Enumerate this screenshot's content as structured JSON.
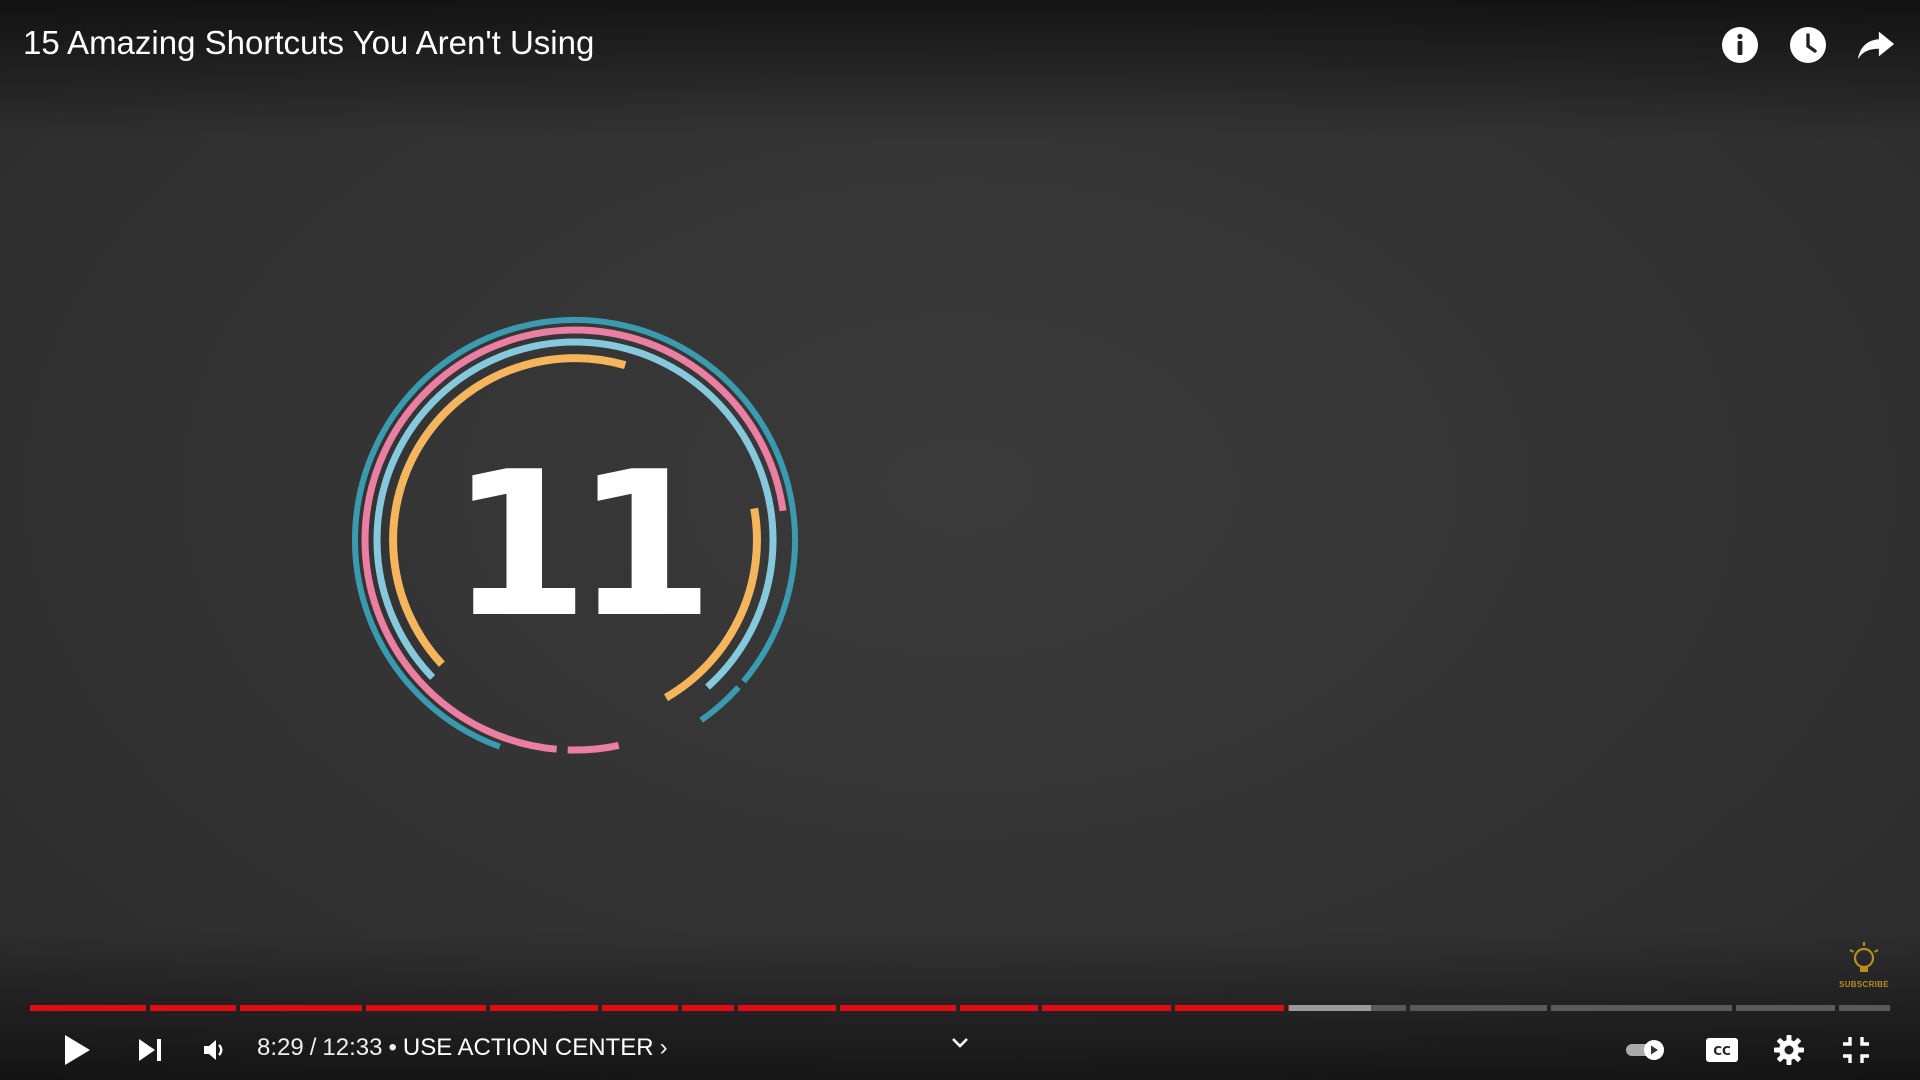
{
  "video": {
    "title": "15 Amazing Shortcuts You Aren't Using",
    "emblem_number": "11"
  },
  "top_actions": {
    "info_icon": "info-icon",
    "watch_later_icon": "clock-icon",
    "share_icon": "share-icon"
  },
  "watermark": {
    "text": "SUBSCRIBE",
    "icon": "lightbulb-icon",
    "color": "#b88f1e"
  },
  "player": {
    "current_time": "8:29",
    "separator": "/",
    "duration": "12:33",
    "chapter_bullet": "•",
    "chapter_title": "USE ACTION CENTER",
    "chapter_chevron": "›",
    "progress_fraction": 0.676,
    "buffered_fraction": 0.72,
    "colors": {
      "played": "#e50914",
      "buffered": "#9a9a9a",
      "track": "#5a5a5a",
      "ring_outer": "#3a9bb0",
      "ring_pink": "#ea7ea3",
      "ring_lightblue": "#86c9dd",
      "ring_orange": "#f5b55c"
    }
  },
  "controls_right": {
    "autoplay_icon": "autoplay-toggle-icon",
    "captions_icon": "cc-icon",
    "settings_icon": "gear-icon",
    "fullscreen_exit_icon": "exit-fullscreen-icon"
  }
}
